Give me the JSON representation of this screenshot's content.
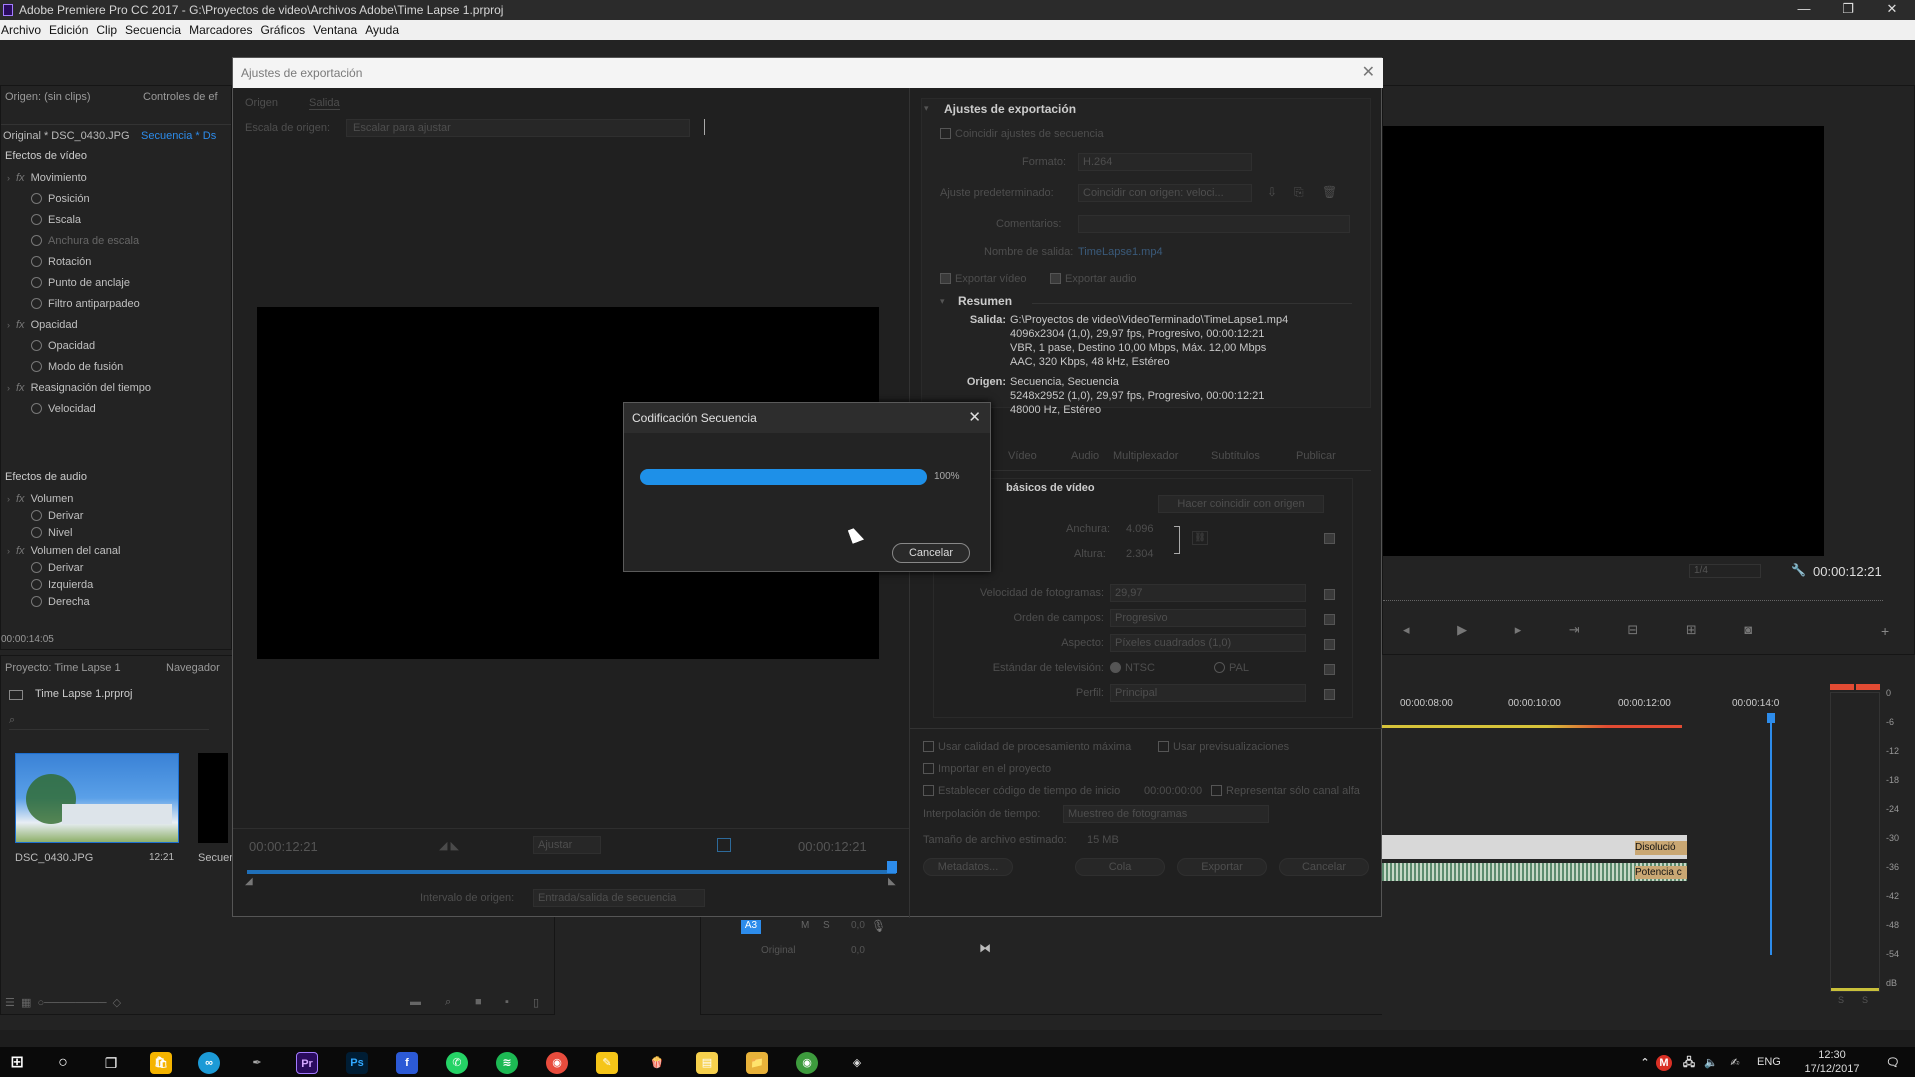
{
  "window": {
    "title": "Adobe Premiere Pro CC 2017 - G:\\Proyectos de video\\Archivos Adobe\\Time Lapse 1.prproj",
    "controls": [
      "—",
      "❐",
      "✕"
    ]
  },
  "menu": [
    "Archivo",
    "Edición",
    "Clip",
    "Secuencia",
    "Marcadores",
    "Gráficos",
    "Ventana",
    "Ayuda"
  ],
  "left_panel": {
    "tabs": [
      "Origen: (sin clips)",
      "Controles de ef"
    ],
    "source_clip": "Original * DSC_0430.JPG",
    "sequence": "Secuencia * Ds",
    "video_effects": "Efectos de vídeo",
    "rows": [
      {
        "label": "Movimiento",
        "type": "fx"
      },
      {
        "label": "Posición",
        "type": "prop"
      },
      {
        "label": "Escala",
        "type": "prop"
      },
      {
        "label": "Anchura de escala",
        "type": "prop-dim"
      },
      {
        "label": "Rotación",
        "type": "prop"
      },
      {
        "label": "Punto de anclaje",
        "type": "prop"
      },
      {
        "label": "Filtro antiparpadeo",
        "type": "prop"
      },
      {
        "label": "Opacidad",
        "type": "fx"
      },
      {
        "label": "Opacidad",
        "type": "prop"
      },
      {
        "label": "Modo de fusión",
        "type": "prop"
      },
      {
        "label": "Reasignación del tiempo",
        "type": "fx"
      },
      {
        "label": "Velocidad",
        "type": "prop"
      }
    ],
    "audio_effects": "Efectos de audio",
    "audio_rows": [
      {
        "label": "Volumen",
        "type": "fx"
      },
      {
        "label": "Derivar",
        "type": "prop"
      },
      {
        "label": "Nivel",
        "type": "prop"
      },
      {
        "label": "Volumen del canal",
        "type": "fx"
      },
      {
        "label": "Derivar",
        "type": "prop"
      },
      {
        "label": "Izquierda",
        "type": "prop"
      },
      {
        "label": "Derecha",
        "type": "prop"
      }
    ],
    "timecode": "00:00:14:05"
  },
  "project_panel": {
    "tabs": [
      "Proyecto: Time Lapse 1",
      "Navegador"
    ],
    "file": "Time Lapse 1.prproj",
    "items": [
      {
        "name": "DSC_0430.JPG",
        "duration": "12:21"
      },
      {
        "name": "Secuen",
        "duration": ""
      }
    ]
  },
  "export_dialog": {
    "title": "Ajustes de exportación",
    "tabs": [
      "Origen",
      "Salida"
    ],
    "source_scaling_label": "Escala de origen:",
    "source_scaling_value": "Escalar para ajustar",
    "timecode_left": "00:00:12:21",
    "timecode_right": "00:00:12:21",
    "fit_label": "Ajustar",
    "range_label": "Intervalo de origen:",
    "range_value": "Entrada/salida de secuencia",
    "settings_header": "Ajustes de exportación",
    "match_sequence": "Coincidir ajustes de secuencia",
    "format_label": "Formato:",
    "format_value": "H.264",
    "preset_label": "Ajuste predeterminado:",
    "preset_value": "Coincidir con origen: veloci...",
    "comments_label": "Comentarios:",
    "output_name_label": "Nombre de salida:",
    "output_name_value": "TimeLapse1.mp4",
    "export_video": "Exportar vídeo",
    "export_audio": "Exportar audio",
    "summary_header": "Resumen",
    "output_label": "Salida:",
    "output_lines": [
      "G:\\Proyectos de video\\VideoTerminado\\TimeLapse1.mp4",
      "4096x2304 (1,0), 29,97 fps, Progresivo, 00:00:12:21",
      "VBR, 1 pase, Destino 10,00 Mbps, Máx. 12,00 Mbps",
      "AAC, 320 Kbps, 48 kHz, Estéreo"
    ],
    "source_label": "Origen:",
    "source_lines": [
      "Secuencia, Secuencia",
      "5248x2952 (1,0), 29,97 fps, Progresivo, 00:00:12:21",
      "48000 Hz, Estéreo"
    ],
    "settings_tabs": [
      "Vídeo",
      "Audio",
      "Multiplexador",
      "Subtítulos",
      "Publicar"
    ],
    "basic_video_header": "básicos de vídeo",
    "match_source_button": "Hacer coincidir con origen",
    "width_label": "Anchura:",
    "width_value": "4.096",
    "height_label": "Altura:",
    "height_value": "2.304",
    "framerate_label": "Velocidad de fotogramas:",
    "framerate_value": "29,97",
    "field_order_label": "Orden de campos:",
    "field_order_value": "Progresivo",
    "aspect_label": "Aspecto:",
    "aspect_value": "Píxeles cuadrados (1,0)",
    "tv_label": "Estándar de televisión:",
    "tv_ntsc": "NTSC",
    "tv_pal": "PAL",
    "profile_label": "Perfil:",
    "profile_value": "Principal",
    "max_quality": "Usar calidad de procesamiento máxima",
    "use_previews": "Usar previsualizaciones",
    "import_project": "Importar en el proyecto",
    "set_start_tc": "Establecer código de tiempo de inicio",
    "start_tc_value": "00:00:00:00",
    "alpha_only": "Representar sólo canal alfa",
    "time_interp_label": "Interpolación de tiempo:",
    "time_interp_value": "Muestreo de fotogramas",
    "est_size_label": "Tamaño de archivo estimado:",
    "est_size_value": "15 MB",
    "buttons": [
      "Metadatos...",
      "Cola",
      "Exportar",
      "Cancelar"
    ]
  },
  "encoding_dialog": {
    "title": "Codificación Secuencia",
    "progress": 100,
    "progress_label": "100%",
    "cancel_button": "Cancelar"
  },
  "program_monitor": {
    "timecode": "00:00:12:21",
    "zoom": "1/4"
  },
  "timeline": {
    "ruler": [
      "00:00:08:00",
      "00:00:10:00",
      "00:00:12:00",
      "00:00:14:0"
    ],
    "track_a3": "A3",
    "track_m": "M",
    "track_s": "S",
    "vol": "0,0",
    "original_label": "Original",
    "original_value": "0,0",
    "transition_video": "Disolució",
    "transition_audio": "Potencia c"
  },
  "meter": {
    "scale": [
      "0",
      "-6",
      "-12",
      "-18",
      "-24",
      "-30",
      "-36",
      "-42",
      "-48",
      "-54",
      "dB"
    ],
    "buttons": [
      "S",
      "S"
    ]
  },
  "taskbar": {
    "language": "ENG",
    "time": "12:30",
    "date": "17/12/2017"
  },
  "colors": {
    "progress": "#1e90e8",
    "accent_blue": "#2d8ceb",
    "premiere": "#2a0b5e"
  }
}
